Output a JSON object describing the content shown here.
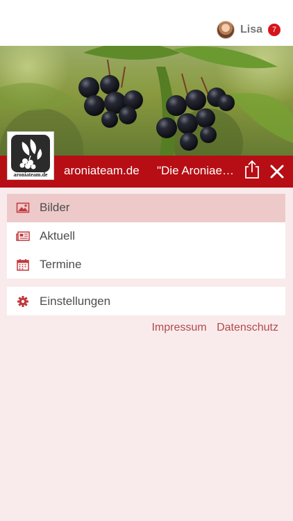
{
  "header": {
    "user_name": "Lisa",
    "notification_count": "7"
  },
  "banner": {
    "logo_text": "aroniateam.de",
    "site_title": "aroniateam.de",
    "page_title": "\"Die Aroniaerntezeit hat begonnen\""
  },
  "menu": {
    "items": [
      {
        "label": "Bilder",
        "icon": "image-icon",
        "active": true
      },
      {
        "label": "Aktuell",
        "icon": "news-icon",
        "active": false
      },
      {
        "label": "Termine",
        "icon": "calendar-icon",
        "active": false
      }
    ],
    "settings": {
      "label": "Einstellungen",
      "icon": "gear-icon"
    }
  },
  "footer": {
    "impressum": "Impressum",
    "datenschutz": "Datenschutz"
  },
  "colors": {
    "accent": "#b60e14",
    "active_item": "#eec9ca",
    "background": "#f9ebeb",
    "link": "#b14a4c",
    "badge": "#d7141c"
  }
}
